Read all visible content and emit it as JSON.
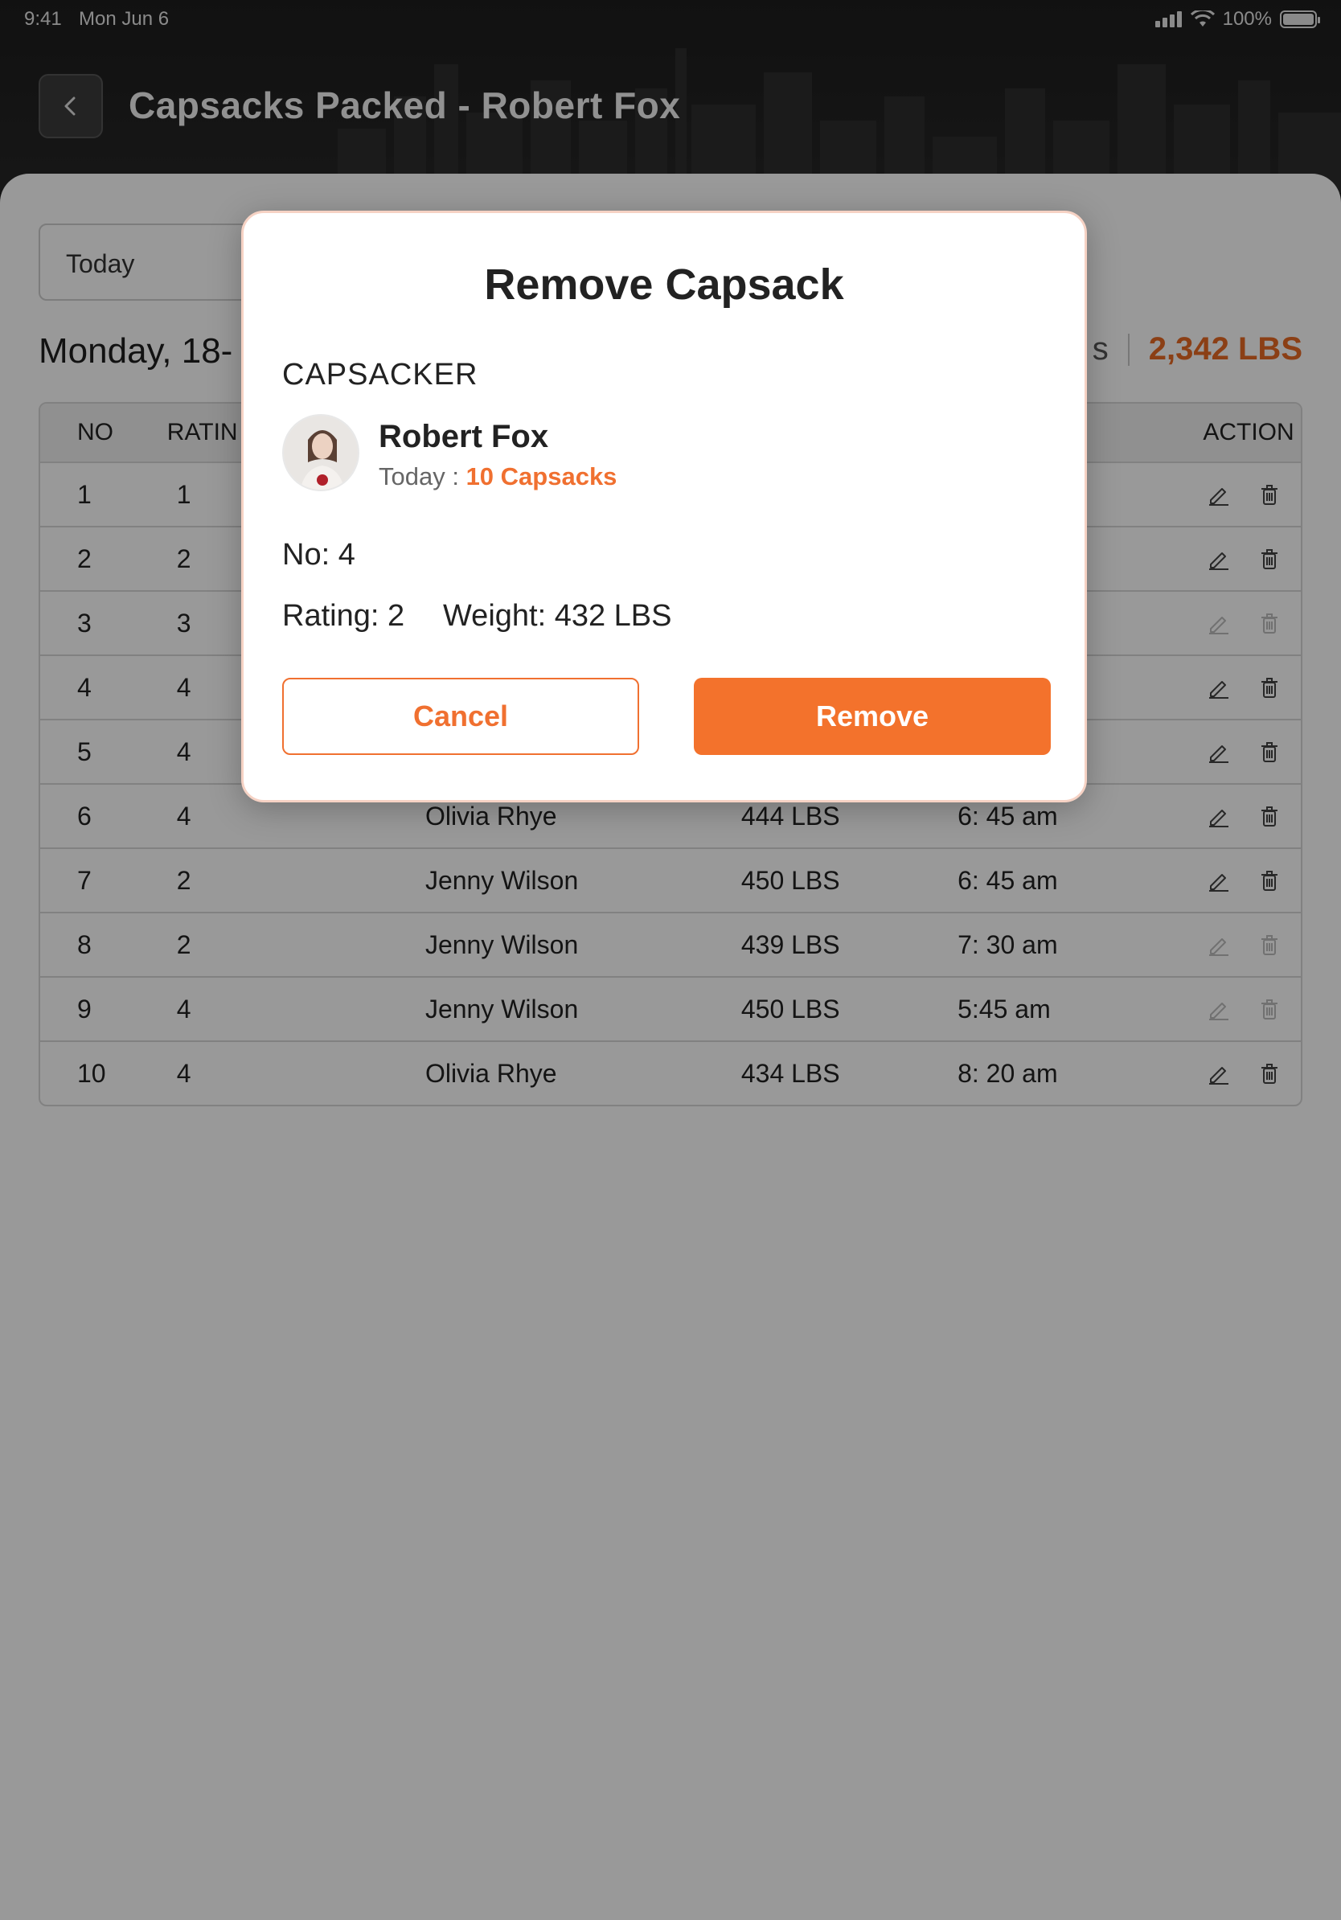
{
  "status_bar": {
    "time": "9:41",
    "date": "Mon Jun 6",
    "battery": "100%",
    "battery_level": 1.0
  },
  "header": {
    "title": "Capsacks Packed - Robert Fox",
    "back_icon": "chevron-left-icon"
  },
  "filters": {
    "date_select_value": "Today"
  },
  "summary": {
    "date_heading_visible": "Monday, 18-",
    "capsacks_partial": "s",
    "total_weight": "2,342 LBS"
  },
  "table": {
    "headers": {
      "no": "NO",
      "rating": "RATIN",
      "action": "ACTION"
    },
    "rows": [
      {
        "no": "1",
        "rating": "1",
        "name": "",
        "weight": "",
        "time": "",
        "enabled": true
      },
      {
        "no": "2",
        "rating": "2",
        "name": "",
        "weight": "",
        "time": "",
        "enabled": true
      },
      {
        "no": "3",
        "rating": "3",
        "name": "",
        "weight": "",
        "time": "",
        "enabled": false
      },
      {
        "no": "4",
        "rating": "4",
        "name": "",
        "weight": "",
        "time": "",
        "enabled": true
      },
      {
        "no": "5",
        "rating": "4",
        "name": "",
        "weight": "",
        "time": "",
        "enabled": true
      },
      {
        "no": "6",
        "rating": "4",
        "name": "Olivia Rhye",
        "weight": "444 LBS",
        "time": "6: 45 am",
        "enabled": true
      },
      {
        "no": "7",
        "rating": "2",
        "name": "Jenny Wilson",
        "weight": "450 LBS",
        "time": "6: 45 am",
        "enabled": true
      },
      {
        "no": "8",
        "rating": "2",
        "name": "Jenny Wilson",
        "weight": "439 LBS",
        "time": "7: 30 am",
        "enabled": false
      },
      {
        "no": "9",
        "rating": "4",
        "name": "Jenny Wilson",
        "weight": "450 LBS",
        "time": "5:45 am",
        "enabled": false
      },
      {
        "no": "10",
        "rating": "4",
        "name": "Olivia Rhye",
        "weight": "434 LBS",
        "time": "8: 20 am",
        "enabled": true
      }
    ]
  },
  "modal": {
    "title": "Remove Capsack",
    "section_label": "CAPSACKER",
    "capsacker_name": "Robert Fox",
    "today_label": "Today : ",
    "capsack_count": "10 Capsacks",
    "no_line": "No: 4",
    "rating_line": "Rating: 2",
    "weight_line": "Weight: 432 LBS",
    "cancel_label": "Cancel",
    "remove_label": "Remove"
  },
  "colors": {
    "accent": "#f3722c",
    "accent_text": "#f07030",
    "total_weight": "#e86a24"
  }
}
